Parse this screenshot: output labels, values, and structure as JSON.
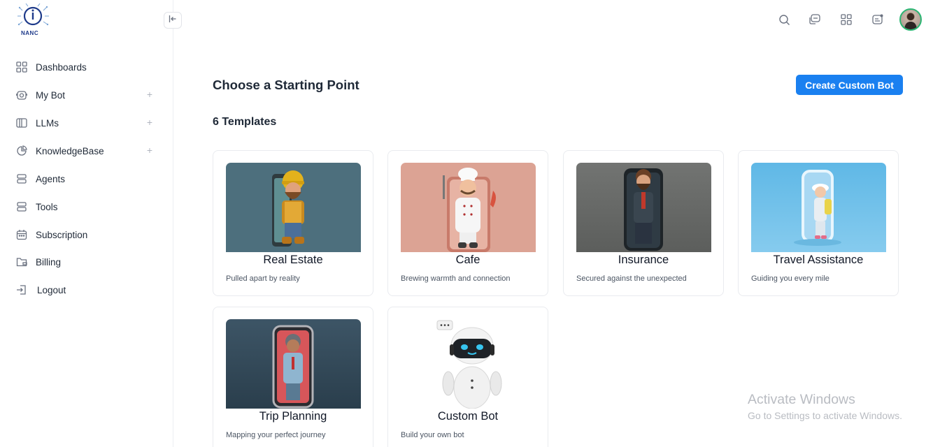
{
  "app": {
    "logo_text": "NANC"
  },
  "sidebar": {
    "items": [
      {
        "label": "Dashboards",
        "icon": "grid-icon",
        "expandable": false
      },
      {
        "label": "My Bot",
        "icon": "bot-icon",
        "expandable": true
      },
      {
        "label": "LLMs",
        "icon": "book-icon",
        "expandable": true
      },
      {
        "label": "KnowledgeBase",
        "icon": "pie-icon",
        "expandable": true
      },
      {
        "label": "Agents",
        "icon": "stack-icon",
        "expandable": false
      },
      {
        "label": "Tools",
        "icon": "stack-icon",
        "expandable": false
      },
      {
        "label": "Subscription",
        "icon": "calendar-icon",
        "expandable": false
      },
      {
        "label": "Billing",
        "icon": "folder-icon",
        "expandable": false
      },
      {
        "label": "Logout",
        "icon": "logout-icon",
        "expandable": false
      }
    ],
    "plus_symbol": "+"
  },
  "topbar": {
    "icons": [
      "search-icon",
      "chat-icon",
      "apps-icon",
      "message-icon"
    ]
  },
  "main": {
    "title": "Choose a Starting Point",
    "create_button": "Create Custom Bot",
    "template_count": "6 Templates",
    "cards": [
      {
        "title": "Real Estate",
        "desc": "Pulled apart by reality",
        "image": "builder-character"
      },
      {
        "title": "Cafe",
        "desc": "Brewing warmth and connection",
        "image": "chef-character"
      },
      {
        "title": "Insurance",
        "desc": "Secured against the unexpected",
        "image": "businessman-character"
      },
      {
        "title": "Travel Assistance",
        "desc": "Guiding you every mile",
        "image": "traveler-character"
      },
      {
        "title": "Trip Planning",
        "desc": "Mapping your perfect journey",
        "image": "doctor-character"
      },
      {
        "title": "Custom Bot",
        "desc": "Build your own bot",
        "image": "robot-character"
      }
    ]
  },
  "watermark": {
    "line1": "Activate Windows",
    "line2": "Go to Settings to activate Windows."
  },
  "colors": {
    "accent": "#1a80f0",
    "avatar_ring": "#2bb673"
  }
}
